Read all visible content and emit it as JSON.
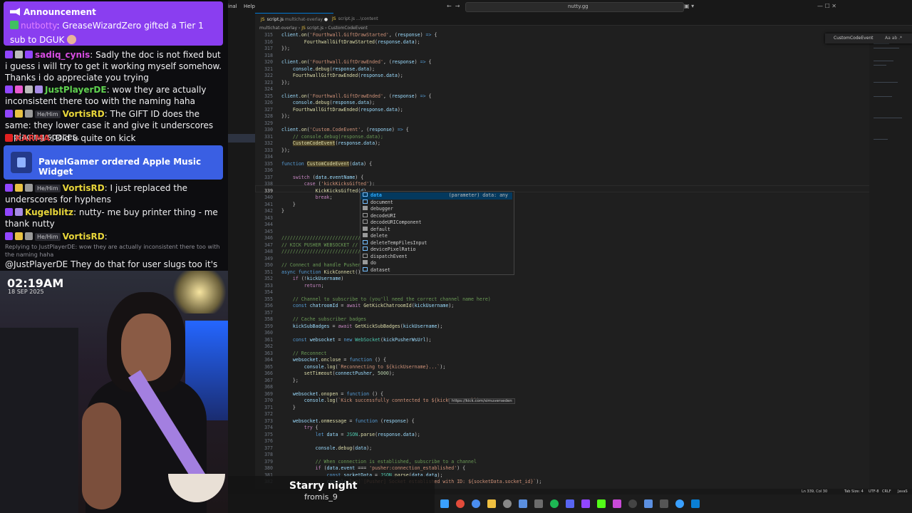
{
  "chat": {
    "announcement": {
      "header": "Announcement",
      "user": "nutbotty",
      "text": ": GreaseWizardZero gifted a Tier 1 sub to DGUK"
    },
    "messages": [
      {
        "name": "sadiq_cynis",
        "name_color": "#d64ce0",
        "pronoun": "",
        "text": ": Sadly the doc is not fixed but i guess i will try to get it working myself somehow. Thanks i do appreciate you trying",
        "reply": ""
      },
      {
        "name": "JustPlayerDE",
        "name_color": "#5fd14f",
        "pronoun": "",
        "text": ": wow they are actually inconsistent there too with the naming haha",
        "reply": ""
      },
      {
        "name": "VortisRD",
        "name_color": "#e8d63a",
        "pronoun": "He/Him",
        "text": ": The GIFT ID does the same: they lower case it and give it underscores replacing spaces.",
        "reply": ""
      },
      {
        "name": "KARMA",
        "name_color": "#e23a3a",
        "pronoun": "",
        "text": ": Did u quite on kick",
        "reply": ""
      },
      {
        "name": "VortisRD",
        "name_color": "#e8d63a",
        "pronoun": "He/Him",
        "text": ": I just replaced the underscores for hyphens",
        "reply": ""
      },
      {
        "name": "Kugelblitz",
        "name_color": "#e8d63a",
        "pronoun": "",
        "text": ": nutty- me buy printer thing - me thank nutty",
        "reply": ""
      },
      {
        "name": "VortisRD",
        "name_color": "#e8d63a",
        "pronoun": "He/Him",
        "text": ":",
        "reply": "Replying to JustPlayerDE: wow they are actually inconsistent there too with the naming haha"
      }
    ],
    "last_text": "@JustPlayerDE They do that for user slugs too it's annoying",
    "order_alert": "PawelGamer ordered Apple Music Widget"
  },
  "cam": {
    "time": "02:19AM",
    "date": "18 SEP 2025"
  },
  "ide": {
    "menu": [
      "inal",
      "Help"
    ],
    "search": "nutty.gg",
    "tabs": [
      {
        "file": "script.js",
        "sub": "multichat-overlay",
        "active": true
      },
      {
        "file": "script.js",
        "sub": "...\\content",
        "active": false
      }
    ],
    "breadcrumb": [
      "multichat-overlay",
      "script.js",
      "CustomCodeEvent"
    ],
    "find_widget": {
      "term": "CustomCodeEvent",
      "opts": "Aa ab .*"
    },
    "suggestions": [
      {
        "label": "data",
        "detail": "(parameter) data: any",
        "kind": "var",
        "selected": true
      },
      {
        "label": "document",
        "detail": "",
        "kind": "var",
        "selected": false
      },
      {
        "label": "debugger",
        "detail": "",
        "kind": "kw",
        "selected": false
      },
      {
        "label": "decodeURI",
        "detail": "",
        "kind": "fn",
        "selected": false
      },
      {
        "label": "decodeURIComponent",
        "detail": "",
        "kind": "fn",
        "selected": false
      },
      {
        "label": "default",
        "detail": "",
        "kind": "kw",
        "selected": false
      },
      {
        "label": "delete",
        "detail": "",
        "kind": "kw",
        "selected": false
      },
      {
        "label": "deleteTempFilesInput",
        "detail": "",
        "kind": "var",
        "selected": false
      },
      {
        "label": "devicePixelRatio",
        "detail": "",
        "kind": "var",
        "selected": false
      },
      {
        "label": "dispatchEvent",
        "detail": "",
        "kind": "fn",
        "selected": false
      },
      {
        "label": "do",
        "detail": "",
        "kind": "kw",
        "selected": false
      },
      {
        "label": "dataset",
        "detail": "",
        "kind": "var",
        "selected": false
      }
    ],
    "hover_link": "https://kick.com/simuverseden",
    "status": {
      "position": "Ln 339, Col 30",
      "tab_size": "Tab Size: 4",
      "encoding": "UTF-8",
      "eol": "CRLF",
      "lang": "JavaS"
    }
  },
  "now_playing": {
    "title": "Starry night",
    "artist": "fromis_9"
  }
}
